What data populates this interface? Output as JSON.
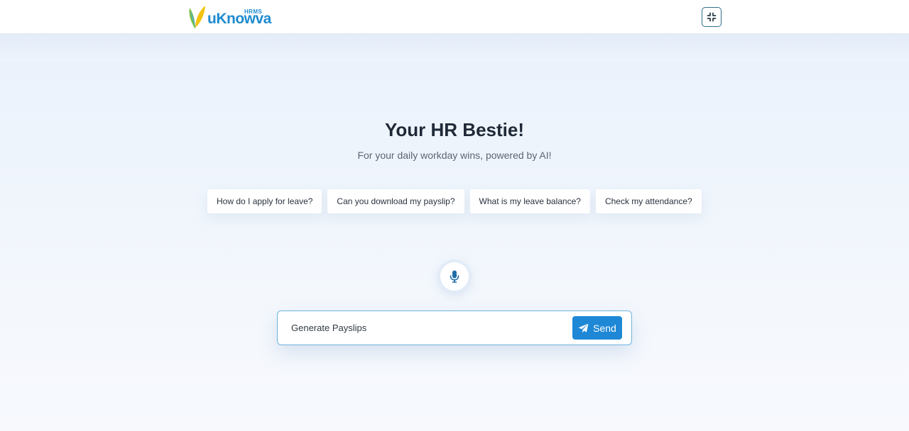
{
  "header": {
    "logo": {
      "brand": "uKnowva",
      "superscript": "HRMS",
      "icon": "butterfly-logo-icon"
    },
    "collapse_button": {
      "icon": "collapse-icon"
    }
  },
  "hero": {
    "title": "Your HR Bestie!",
    "subtitle": "For your daily workday wins, powered by AI!"
  },
  "suggestions": [
    {
      "label": "How do I apply for leave?"
    },
    {
      "label": "Can you download my payslip?"
    },
    {
      "label": "What is my leave balance?"
    },
    {
      "label": "Check my attendance?"
    }
  ],
  "mic_button": {
    "icon": "microphone-icon"
  },
  "chat": {
    "input_value": "Generate Payslips",
    "send_label": "Send",
    "send_icon": "paper-plane-icon"
  },
  "colors": {
    "brand_blue": "#1e88d6",
    "brand_green": "#7cc242",
    "brand_yellow": "#f2c20d",
    "title_text": "#1f2937"
  }
}
